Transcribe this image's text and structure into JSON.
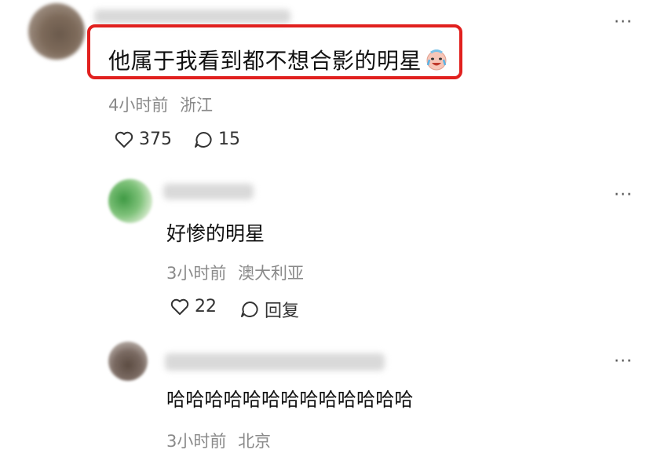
{
  "comments": [
    {
      "text": "他属于我看到都不想合影的明星",
      "emoji": "crying-laughing-emoji",
      "time": "4小时前",
      "location": "浙江",
      "likes": "375",
      "replies": "15"
    },
    {
      "text": "好惨的明星",
      "time": "3小时前",
      "location": "澳大利亚",
      "likes": "22",
      "reply_label": "回复"
    },
    {
      "text": "哈哈哈哈哈哈哈哈哈哈哈哈哈",
      "time": "3小时前",
      "location": "北京"
    }
  ],
  "more_glyph": "···",
  "colors": {
    "highlight": "#e1201e",
    "meta": "#8a8a8a",
    "text": "#111111"
  }
}
